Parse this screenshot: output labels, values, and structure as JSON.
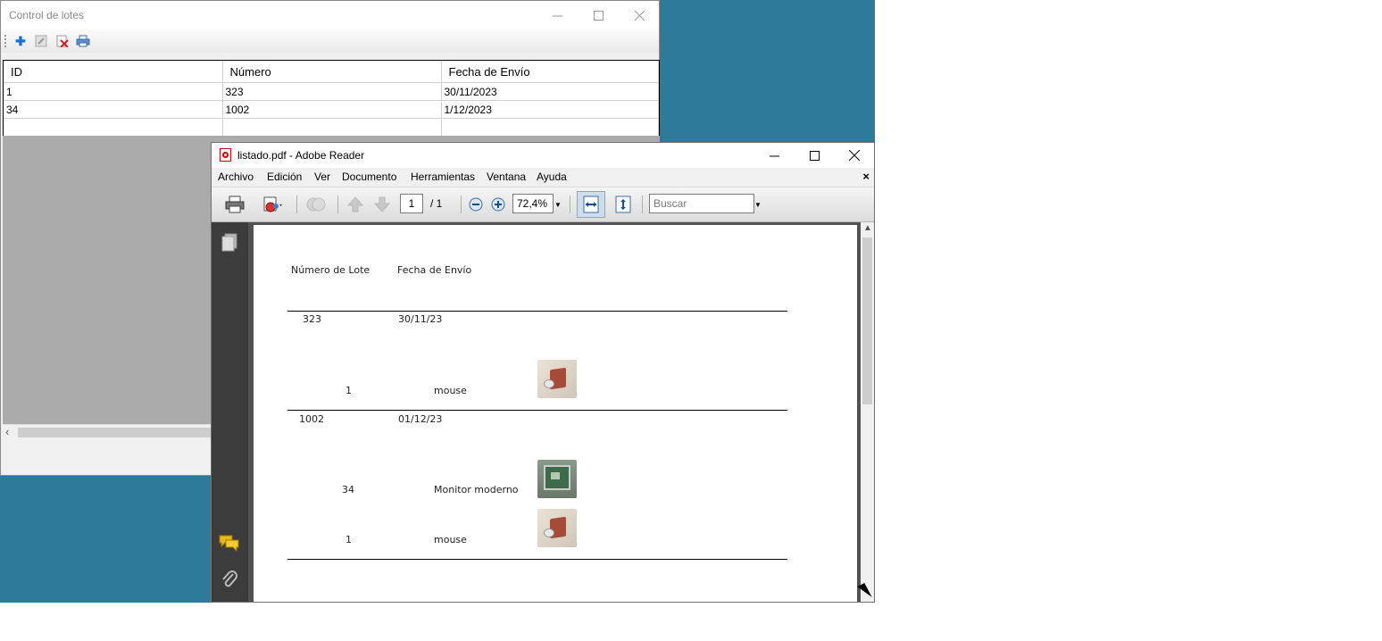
{
  "lotes_window": {
    "title": "Control de lotes",
    "toolbar": {
      "add_icon": "add-icon",
      "edit_icon": "edit-icon",
      "delete_icon": "delete-icon",
      "print_icon": "print-icon"
    },
    "table": {
      "columns": [
        "ID",
        "Número",
        "Fecha de Envío"
      ],
      "rows": [
        {
          "id": "1",
          "numero": "323",
          "fecha": "30/11/2023"
        },
        {
          "id": "34",
          "numero": "1002",
          "fecha": "1/12/2023"
        }
      ]
    }
  },
  "reader_window": {
    "title": "listado.pdf - Adobe Reader",
    "menu": [
      "Archivo",
      "Edición",
      "Ver",
      "Documento",
      "Herramientas",
      "Ventana",
      "Ayuda"
    ],
    "menu_close": "×",
    "toolbar": {
      "page_current": "1",
      "page_total": "/ 1",
      "zoom": "72,4%",
      "search_placeholder": "Buscar"
    },
    "document": {
      "header_lote": "Número de Lote",
      "header_fecha": "Fecha de Envío",
      "lotes": [
        {
          "numero": "323",
          "fecha": "30/11/23",
          "items": [
            {
              "cantidad": "1",
              "producto": "mouse",
              "image": "mouse-image"
            }
          ]
        },
        {
          "numero": "1002",
          "fecha": "01/12/23",
          "items": [
            {
              "cantidad": "34",
              "producto": "Monitor moderno",
              "image": "monitor-image"
            },
            {
              "cantidad": "1",
              "producto": "mouse",
              "image": "mouse-image"
            }
          ]
        }
      ]
    }
  }
}
